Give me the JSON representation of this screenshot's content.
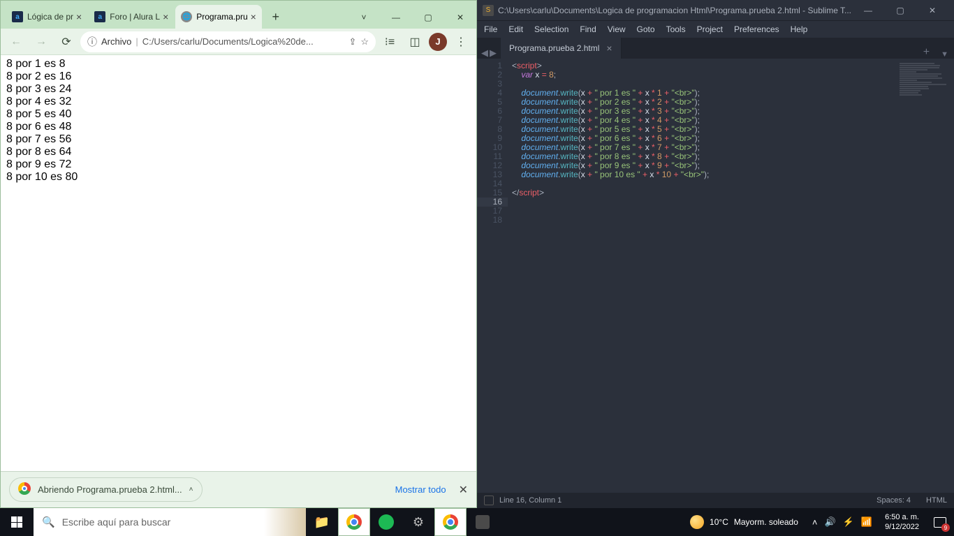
{
  "chrome": {
    "tabs": [
      {
        "title": "Lógica de pr",
        "icon": "alura",
        "iconText": "a",
        "active": false
      },
      {
        "title": "Foro | Alura L",
        "icon": "alura",
        "iconText": "a",
        "active": false
      },
      {
        "title": "Programa.pru",
        "icon": "globe",
        "iconText": "🌐",
        "active": true
      }
    ],
    "url": {
      "info": "ⓘ",
      "label": "Archivo",
      "path": "C:/Users/carlu/Documents/Logica%20de..."
    },
    "profile": "J",
    "page_lines": [
      "8 por 1 es 8",
      "8 por 2 es 16",
      "8 por 3 es 24",
      "8 por 4 es 32",
      "8 por 5 es 40",
      "8 por 6 es 48",
      "8 por 7 es 56",
      "8 por 8 es 64",
      "8 por 9 es 72",
      "8 por 10 es 80"
    ],
    "download": {
      "text": "Abriendo Programa.prueba 2.html...",
      "showall": "Mostrar todo"
    }
  },
  "sublime": {
    "title": "C:\\Users\\carlu\\Documents\\Logica de programacion Html\\Programa.prueba 2.html - Sublime T...",
    "menu": [
      "File",
      "Edit",
      "Selection",
      "Find",
      "View",
      "Goto",
      "Tools",
      "Project",
      "Preferences",
      "Help"
    ],
    "tab": "Programa.prueba 2.html",
    "gutter": [
      "1",
      "2",
      "3",
      "4",
      "5",
      "6",
      "7",
      "8",
      "9",
      "10",
      "11",
      "12",
      "13",
      "14",
      "15",
      "16",
      "17",
      "18"
    ],
    "gutter_current": 16,
    "code": {
      "x": "8",
      "lines": [
        1,
        2,
        3,
        4,
        5,
        6,
        7,
        8,
        9,
        10
      ]
    },
    "status": {
      "left": "Line 16, Column 1",
      "spaces": "Spaces: 4",
      "lang": "HTML"
    }
  },
  "taskbar": {
    "search_placeholder": "Escribe aquí para buscar",
    "weather": {
      "temp": "10°C",
      "desc": "Mayorm. soleado"
    },
    "clock": {
      "time": "6:50 a. m.",
      "date": "9/12/2022"
    },
    "notif": "9"
  }
}
